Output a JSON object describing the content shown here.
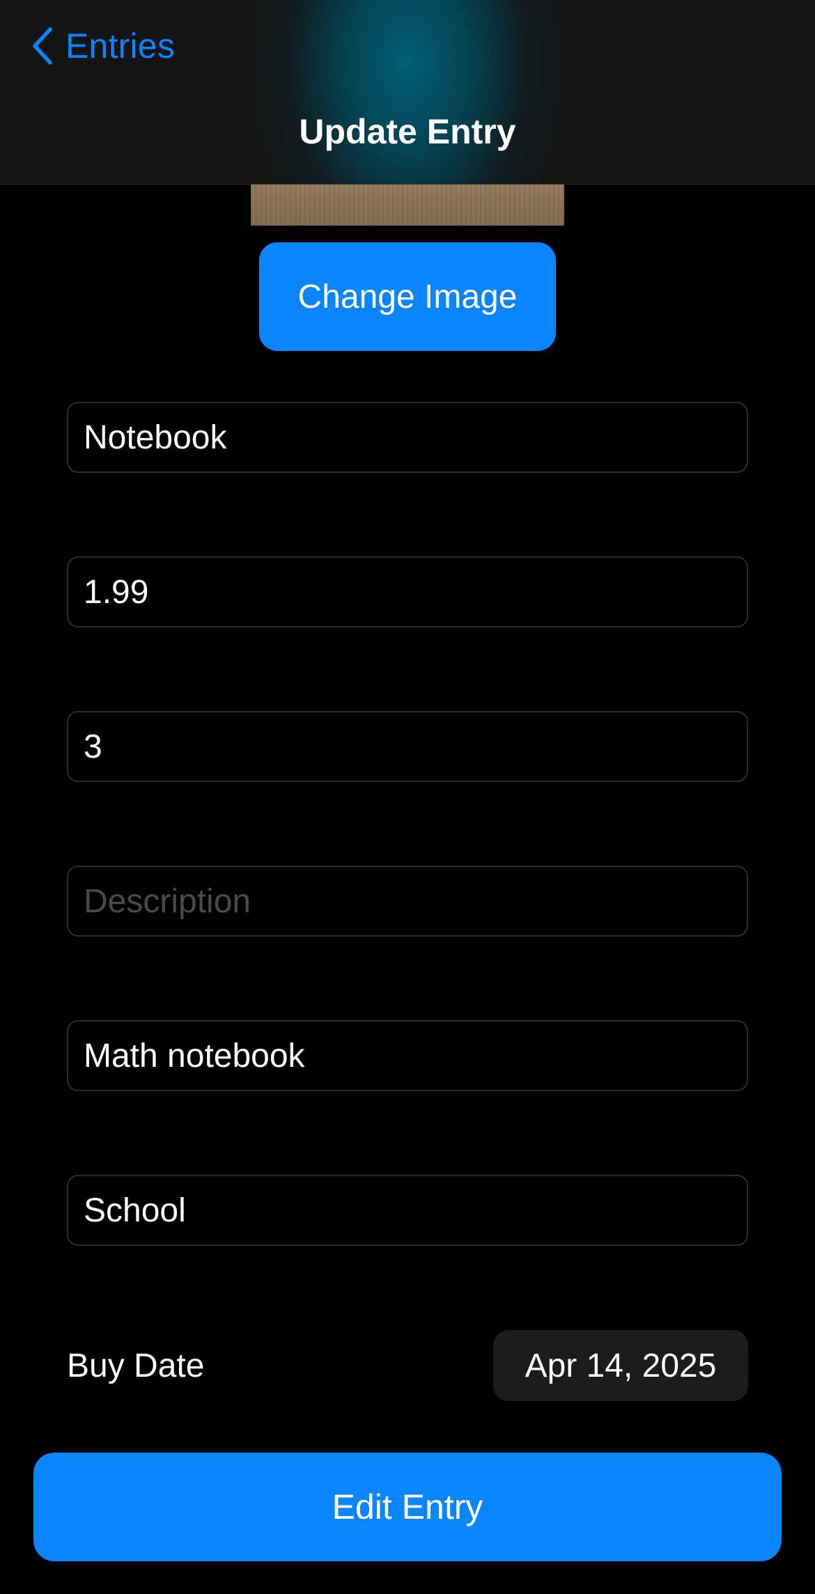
{
  "nav": {
    "back_label": "Entries",
    "title": "Update Entry"
  },
  "image": {
    "change_label": "Change Image"
  },
  "form": {
    "name": {
      "value": "Notebook",
      "placeholder": ""
    },
    "price": {
      "value": "1.99",
      "placeholder": ""
    },
    "quantity": {
      "value": "3",
      "placeholder": ""
    },
    "description": {
      "value": "",
      "placeholder": "Description"
    },
    "notes": {
      "value": "Math notebook",
      "placeholder": ""
    },
    "category": {
      "value": "School",
      "placeholder": ""
    },
    "buy_date_label": "Buy Date",
    "buy_date_value": "Apr 14, 2025"
  },
  "actions": {
    "submit_label": "Edit Entry"
  },
  "icons": {
    "back": "chevron-left-icon"
  },
  "colors": {
    "accent": "#0a84ff",
    "background": "#000000",
    "nav_background": "#141414",
    "field_border": "#2c2c2e",
    "placeholder": "#4a4a4e",
    "chip_background": "#1c1c1e"
  }
}
